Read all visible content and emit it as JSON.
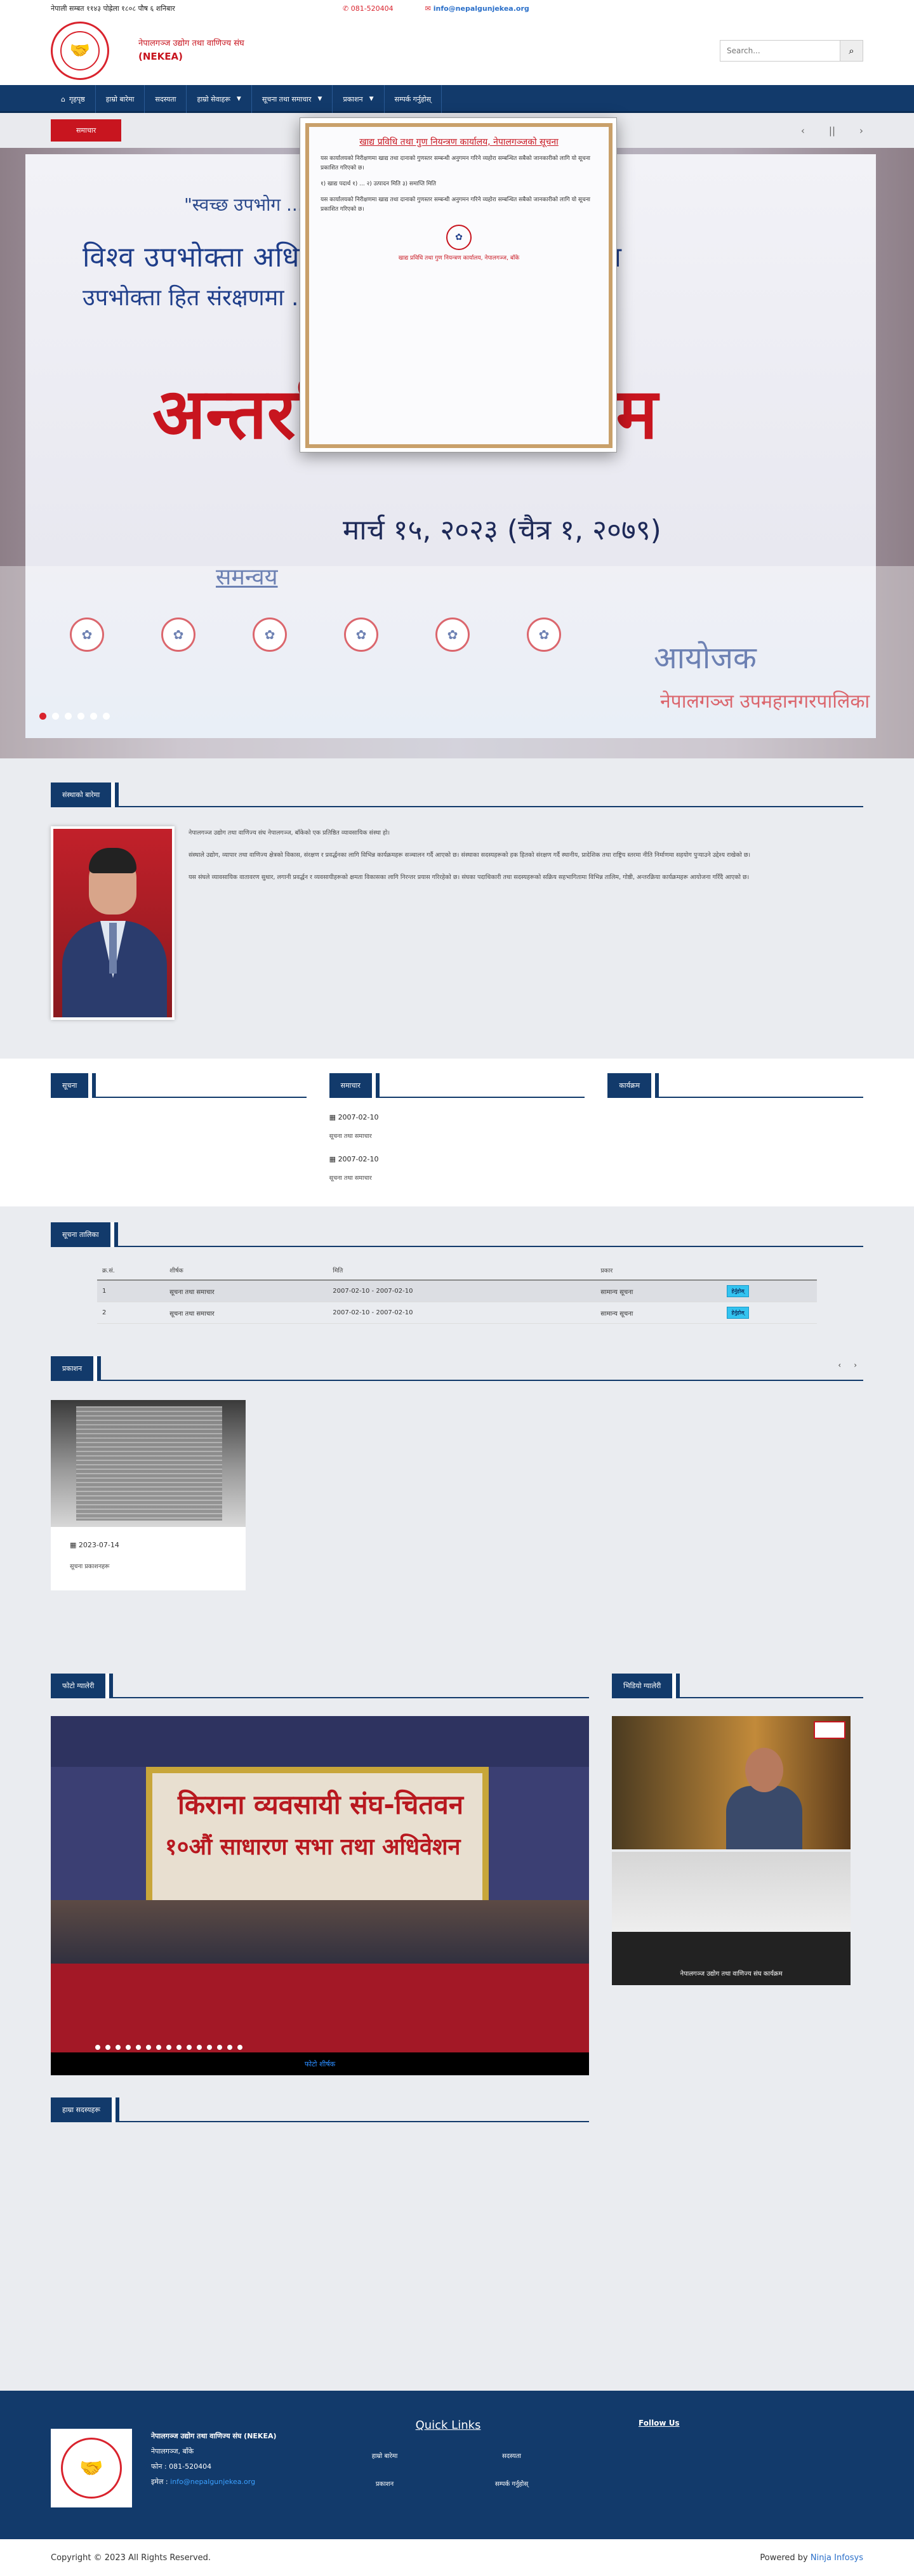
{
  "topbar": {
    "date": "नेपाली सम्बत ११४३ पोह्रेला १८०८ पौष ६ शनिबार",
    "phone": "081-520404",
    "email": "info@nepalgunjekea.org"
  },
  "header": {
    "org_name_np": "नेपालगञ्ज उद्योग तथा वाणिज्य संघ",
    "org_abbr": "(NEKEA)",
    "search_placeholder": "Search..."
  },
  "nav": {
    "items": [
      "गृहपृष्ठ",
      "हाम्रो बारेमा",
      "सदस्यता",
      "हाम्रो सेवाहरू",
      "सूचना तथा समाचार",
      "प्रकाशन",
      "सम्पर्क गर्नुहोस्"
    ]
  },
  "ticker": {
    "label": "समाचार",
    "pause": "||"
  },
  "banner": {
    "line1": "\"स्वच्छ उपभोग ... Empowering ... Transition\"",
    "line2": "विश्व उपभोक्ता अधिकार दिवस २०२३ को अवसरमा",
    "line3": "उपभोक्ता हित संरक्षणमा ... रुको भूमिका विषयक",
    "line4": "अन्तरक्रिया कार्यक्रम",
    "line5": "मार्च १५, २०२३ (चैत्र १, २०७९)",
    "line6": "समन्वय",
    "line7": "आयोजक",
    "line8": "नेपालगञ्ज उपमहानगरपालिका"
  },
  "popup": {
    "title": "खाद्य प्रविधि तथा गुण नियन्त्रण कार्यालय, नेपालगञ्जको सूचना",
    "body": "यस कार्यालयको निरीक्षणमा खाद्य तथा दानाको गुणस्तर सम्बन्धी अनुगमन गरिने व्यहोरा सम्बन्धित सबैको जानकारीको लागि यो सूचना प्रकाशित गरिएको छ।",
    "list": "१) खाद्य पदार्थ १) ...  २) उत्पादन मिति  ३) समाप्ति मिति",
    "footer": "खाद्य प्रविधि तथा गुण नियन्त्रण कार्यालय, नेपालगञ्ज, बाँके"
  },
  "about": {
    "heading": "संस्थाको बारेमा",
    "para1": "नेपालगञ्ज उद्योग तथा वाणिज्य संघ नेपालगञ्ज, बाँकेको एक प्रतिष्ठित व्यावसायिक संस्था हो।",
    "para2": "संस्थाले उद्योग, व्यापार तथा वाणिज्य क्षेत्रको विकास, संरक्षण र प्रवर्द्धनका लागि विभिन्न कार्यक्रमहरू सञ्चालन गर्दै आएको छ। संस्थाका सदस्यहरूको हक हितको संरक्षण गर्दै स्थानीय, प्रादेशिक तथा राष्ट्रिय स्तरमा नीति निर्माणमा सहयोग पुर्‍याउने उद्देश्य राखेको छ।",
    "para3": "यस संघले व्यावसायिक वातावरण सुधार, लगानी प्रवर्द्धन र व्यवसायीहरूको क्षमता विकासका लागि निरन्तर प्रयास गरिरहेको छ। संघका पदाधिकारी तथा सदस्यहरूको सक्रिय सहभागितामा विभिन्न तालिम, गोष्ठी, अन्तरक्रिया कार्यक्रमहरू आयोजना गरिँदै आएको छ।"
  },
  "cols": {
    "col1_title": "सूचना",
    "col2_title": "समाचार",
    "col3_title": "कार्यक्रम",
    "items": [
      {
        "date": "2007-02-10",
        "title": "सूचना तथा समाचार"
      },
      {
        "date": "2007-02-10",
        "title": "सूचना तथा समाचार"
      }
    ]
  },
  "table": {
    "heading": "सूचना तालिका",
    "headers": [
      "क्र.सं.",
      "शीर्षक",
      "मिति",
      "प्रकार",
      ""
    ],
    "rows": [
      {
        "sn": "1",
        "title": "सूचना तथा समाचार",
        "date": "2007-02-10 - 2007-02-10",
        "type": "सामान्य सूचना",
        "btn": "हेर्नुहोस्"
      },
      {
        "sn": "2",
        "title": "सूचना तथा समाचार",
        "date": "2007-02-10 - 2007-02-10",
        "type": "सामान्य सूचना",
        "btn": "हेर्नुहोस्"
      }
    ]
  },
  "publications": {
    "heading": "प्रकाशन",
    "prev": "‹",
    "next": "›",
    "card": {
      "date": "2023-07-14",
      "title": "सूचना प्रकाशनहरू"
    }
  },
  "gallery": {
    "heading": "फोटो ग्यालेरी",
    "photo_title1": "किराना व्यवसायी संघ-चितवन",
    "photo_title2": "१०औं साधारण सभा तथा अधिवेशन",
    "caption": "फोटो शीर्षक",
    "video_heading": "भिडियो ग्यालेरी",
    "video2_caption": "नेपालगञ्ज उद्योग तथा वाणिज्य संघ कार्यक्रम"
  },
  "members": {
    "heading": "हाम्रा सदस्यहरू"
  },
  "footer": {
    "org_line": "नेपालगञ्ज उद्योग तथा वाणिज्य संघ (NEKEA)",
    "address": "नेपालगञ्ज, बाँके",
    "phone_label": "फोन : 081-520404",
    "email_label": "इमेल : ",
    "email": "info@nepalgunjekea.org",
    "quick_links_title": "Quick Links",
    "quick_links": [
      "हाम्रो बारेमा",
      "सदस्यता",
      "प्रकाशन",
      "सम्पर्क गर्नुहोस्"
    ],
    "follow_title": "Follow Us"
  },
  "copyright": {
    "left": "Copyright © 2023 All Rights Reserved.",
    "powered": "Powered by ",
    "company": "Ninja Infosys"
  }
}
